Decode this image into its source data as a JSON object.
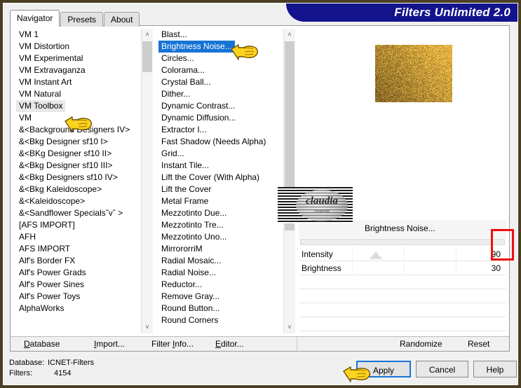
{
  "window": {
    "title": "Filters Unlimited 2.0",
    "accent_blue": "#13138c",
    "selection_blue": "#1673d6",
    "highlight_red": "#f20d0d"
  },
  "tabs": [
    {
      "label": "Navigator",
      "active": true
    },
    {
      "label": "Presets",
      "active": false
    },
    {
      "label": "About",
      "active": false
    }
  ],
  "navigator_list": {
    "name": "filter-category-list",
    "selected": "VM Toolbox",
    "items": [
      "VM 1",
      "VM Distortion",
      "VM Experimental",
      "VM Extravaganza",
      "VM Instant Art",
      "VM Natural",
      "VM Toolbox",
      "VM",
      "&<Background Designers IV>",
      "&<Bkg Designer sf10 I>",
      "&<BKg Designer sf10 II>",
      "&<Bkg Designer sf10 III>",
      "&<Bkg Designers sf10 IV>",
      "&<Bkg Kaleidoscope>",
      "&<Kaleidoscope>",
      "&<Sandflower Specialsˇvˇ >",
      "[AFS IMPORT]",
      "AFH",
      "AFS IMPORT",
      "Alf's Border FX",
      "Alf's Power Grads",
      "Alf's Power Sines",
      "Alf's Power Toys",
      "AlphaWorks"
    ]
  },
  "filter_list": {
    "name": "filter-effect-list",
    "selected": "Brightness Noise...",
    "items": [
      "Blast...",
      "Brightness Noise...",
      "Circles...",
      "Colorama...",
      "Crystal Ball...",
      "Dither...",
      "Dynamic Contrast...",
      "Dynamic Diffusion...",
      "Extractor I...",
      "Fast Shadow (Needs Alpha)",
      "Grid...",
      "Instant Tile...",
      "Lift the Cover (With Alpha)",
      "Lift the Cover",
      "Metal Frame",
      "Mezzotinto Due...",
      "Mezzotinto Tre...",
      "Mezzotinto Uno...",
      "MirrororriM",
      "Radial Mosaic...",
      "Radial Noise...",
      "Reductor...",
      "Remove Gray...",
      "Round Button...",
      "Round Corners"
    ]
  },
  "preview": {
    "effect_name": "Brightness Noise...",
    "watermark_text": "claudia",
    "watermark_sub": "creations"
  },
  "parameters": [
    {
      "name": "Intensity",
      "value": "90"
    },
    {
      "name": "Brightness",
      "value": "30"
    }
  ],
  "toolbar": {
    "database": "Database",
    "import": "Import...",
    "filter_info": "Filter Info...",
    "editor": "Editor...",
    "randomize": "Randomize",
    "reset": "Reset"
  },
  "status": {
    "database_label": "Database:",
    "database_value": "ICNET-Filters",
    "filters_label": "Filters:",
    "filters_value": "4154"
  },
  "actions": {
    "apply": "Apply",
    "cancel": "Cancel",
    "help": "Help"
  },
  "icons": {
    "scroll_up": "˄",
    "scroll_down": "˅",
    "hand_pointer": "pointing-hand-icon"
  }
}
